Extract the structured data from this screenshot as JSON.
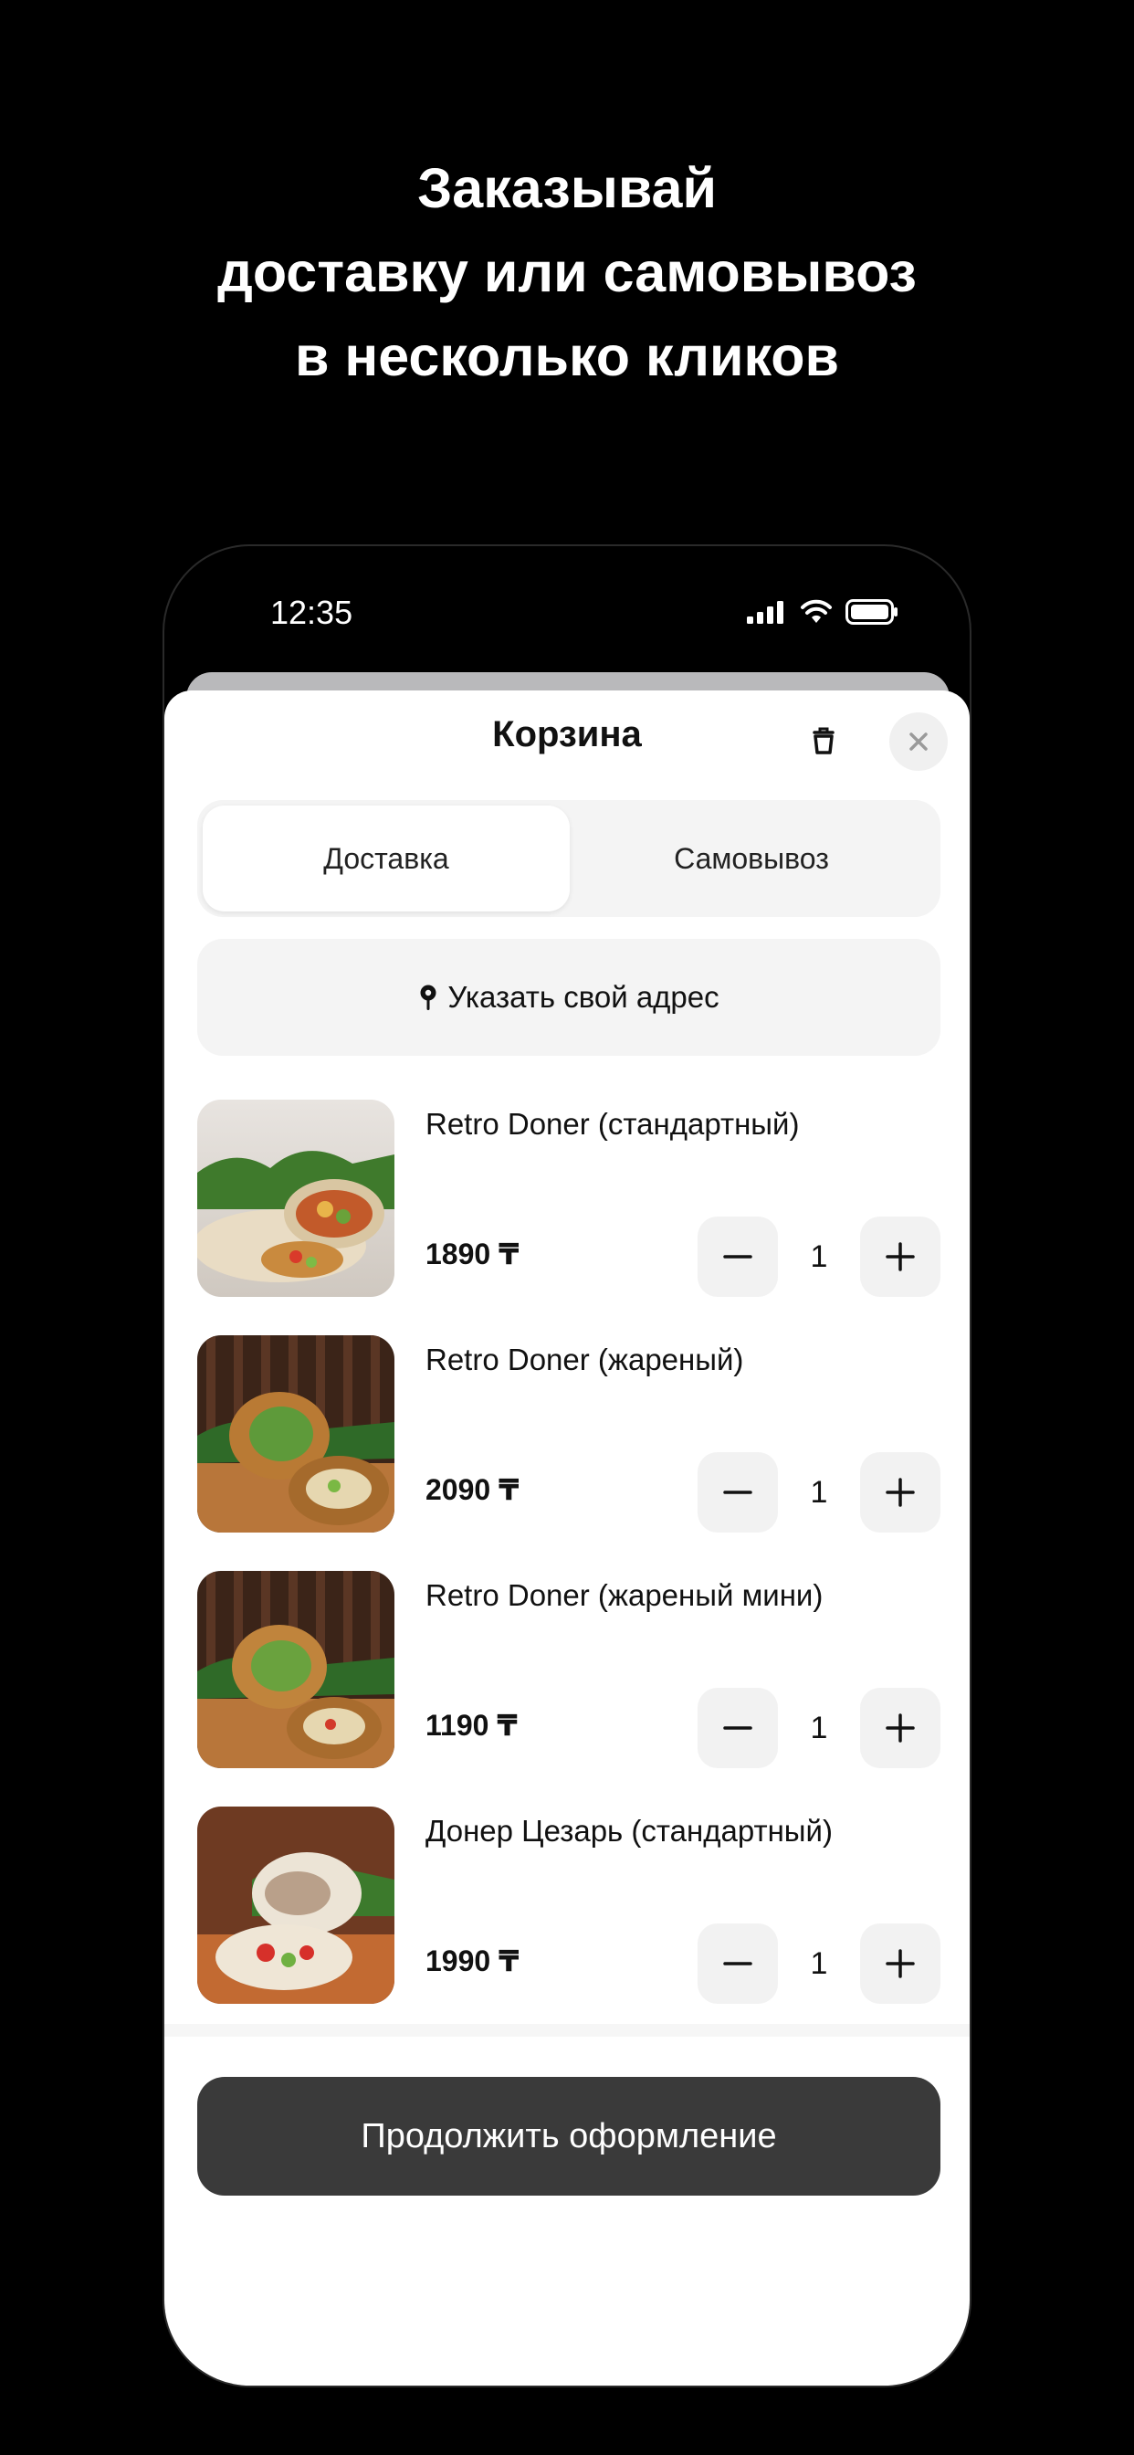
{
  "headline": {
    "line1": "Заказывай",
    "line2": "доставку или самовывоз",
    "line3": "в несколько кликов"
  },
  "status_bar": {
    "time": "12:35",
    "icons": [
      "signal-icon",
      "wifi-icon",
      "battery-icon"
    ]
  },
  "cart": {
    "title": "Корзина",
    "icons": {
      "trash": "trash-icon",
      "close": "close-icon"
    },
    "tabs": [
      {
        "label": "Доставка",
        "selected": true
      },
      {
        "label": "Самовывоз",
        "selected": false
      }
    ],
    "address_button": {
      "label": "Указать свой адрес",
      "icon": "location-pin-icon"
    },
    "items": [
      {
        "name": "Retro Doner (стандартный)",
        "price": "1890 ₸",
        "quantity": "1"
      },
      {
        "name": "Retro Doner (жареный)",
        "price": "2090 ₸",
        "quantity": "1"
      },
      {
        "name": "Retro Doner (жареный мини)",
        "price": "1190 ₸",
        "quantity": "1"
      },
      {
        "name": "Донер Цезарь (стандартный)",
        "price": "1990 ₸",
        "quantity": "1"
      }
    ],
    "continue_button": "Продолжить оформление"
  },
  "colors": {
    "background": "#000000",
    "sheet": "#ffffff",
    "control_bg": "#f4f4f4",
    "primary_button": "#3a3a3a"
  }
}
